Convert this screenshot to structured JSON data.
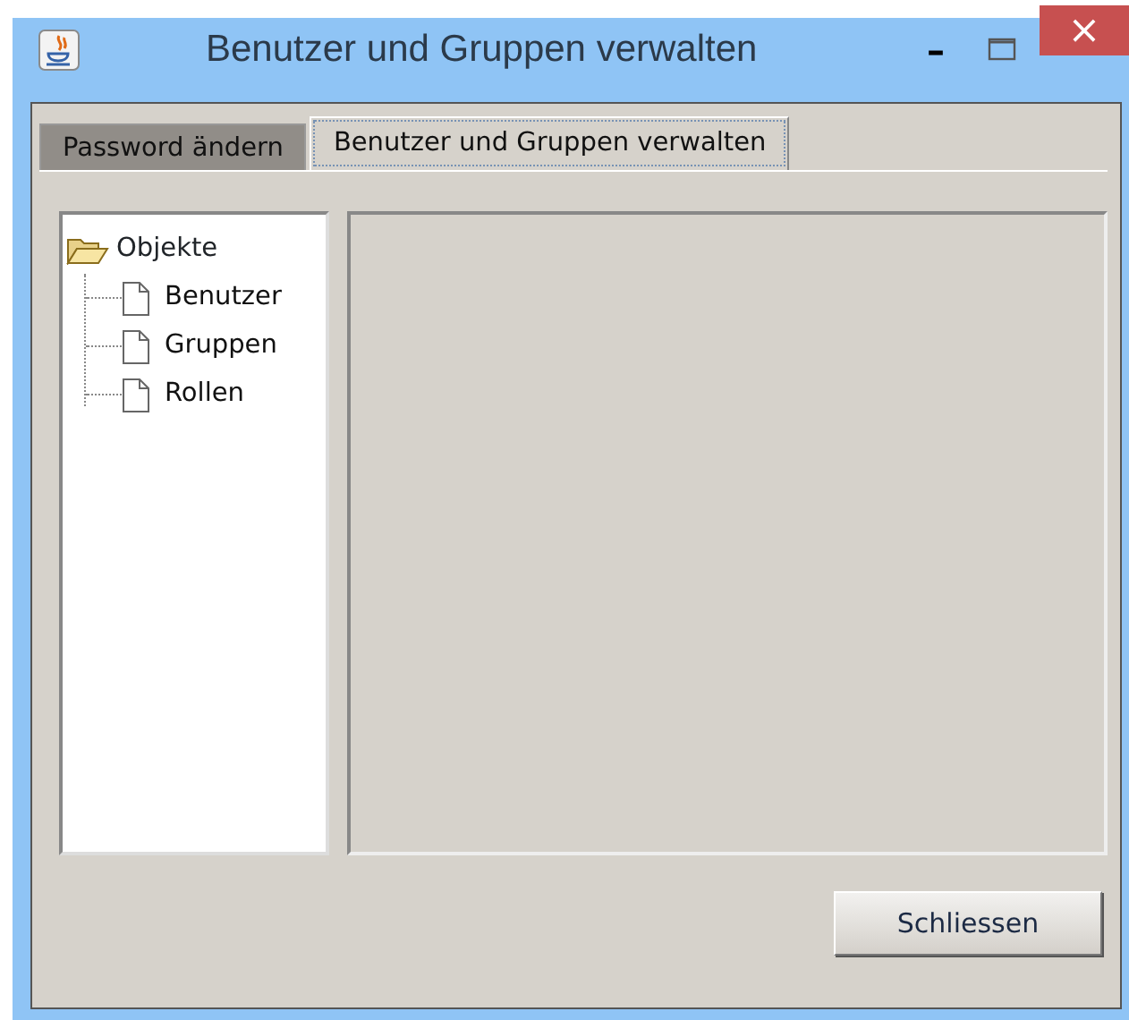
{
  "window": {
    "title": "Benutzer und Gruppen verwalten"
  },
  "title_buttons": {
    "minimize": "–",
    "close": "×"
  },
  "tabs": [
    {
      "label": "Password ändern",
      "selected": false
    },
    {
      "label": "Benutzer und Gruppen verwalten",
      "selected": true
    }
  ],
  "tree": {
    "label": "Objekte",
    "expanded": true,
    "children": [
      {
        "label": "Benutzer"
      },
      {
        "label": "Gruppen"
      },
      {
        "label": "Rollen"
      }
    ]
  },
  "buttons": [
    {
      "label": "Schliessen"
    }
  ]
}
